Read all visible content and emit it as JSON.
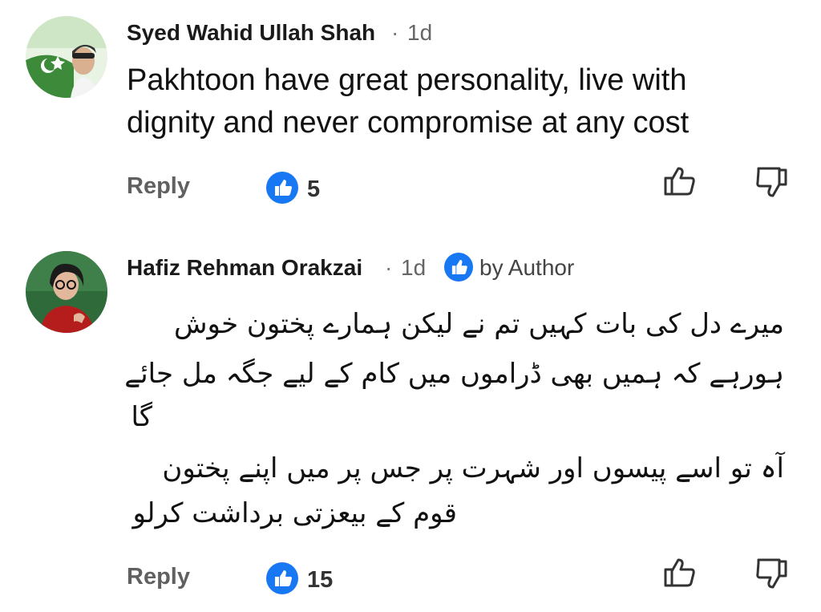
{
  "comments": [
    {
      "author": "Syed Wahid Ullah Shah",
      "time": "1d",
      "text_lines": [
        "Pakhtoon have great personality, live with",
        "dignity and never compromise at any cost"
      ],
      "reply_label": "Reply",
      "like_count": "5"
    },
    {
      "author": "Hafiz Rehman Orakzai",
      "time": "1d",
      "author_tag": "by Author",
      "urdu_lines": [
        "میرے دل کی بات کہیں تم نے لیکن ہمارے پختون خوش",
        "ہورہے کہ ہمیں بھی ڈراموں میں کام کے لیے جگہ مل جائے",
        "گا",
        "آہ تو اسے پیسوں اور شہرت پر جس پر میں اپنے پختون",
        "قوم کے بیعزتی برداشت کرلو"
      ],
      "reply_label": "Reply",
      "like_count": "15"
    }
  ],
  "colors": {
    "accent": "#1877f2",
    "meta": "#666666",
    "reply": "#606060"
  },
  "icons": [
    "thumbs-up-icon",
    "thumbs-down-icon",
    "like-badge-icon",
    "author-badge-icon"
  ]
}
